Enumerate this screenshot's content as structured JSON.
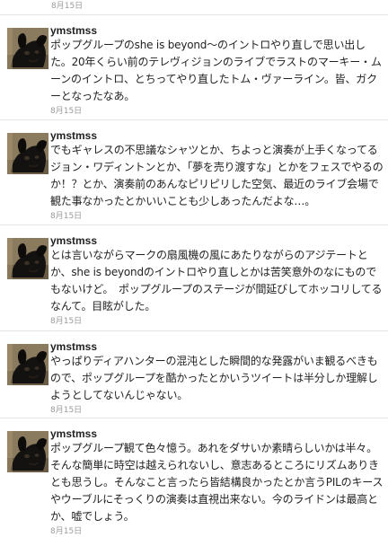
{
  "top_date": "8月15日",
  "tweets": [
    {
      "username": "ymstmss",
      "text": "ポップグループのshe is beyond〜のイントロやり直しで思い出した。20年くらい前のテレヴィジョンのライブでラストのマーキー・ムーンのイントロ、とちってやり直したトム・ヴァーライン。皆、ガクーとなったなあ。",
      "date": "8月15日"
    },
    {
      "username": "ymstmss",
      "text": "でもギャレスの不思議なシャツとか、ちよっと演奏が上手くなってるジョン・ワディントンとか、「夢を売り渡すな」とかをフェスでやるのか！？とか、演奏前のあんなピリピリした空気、最近のライブ会場で観た事なかったとかいいことも少しあったんだよな…。",
      "date": "8月15日"
    },
    {
      "username": "ymstmss",
      "text": "とは言いながらマークの扇風機の風にあたりながらのアジテートとか、she is beyondのイントロやり直しとかは苦笑意外のなにものでもないけど。　ポップグループのステージが間延びしてホッコリしてるなんて。目眩がした。",
      "date": "8月15日"
    },
    {
      "username": "ymstmss",
      "text": "やっぱりディアハンターの混沌とした瞬間的な発露がいま観るべきもので、ポップグループを酷かったとかいうツイートは半分しか理解しようとしてないんじゃない。",
      "date": "8月15日"
    },
    {
      "username": "ymstmss",
      "text": "ポップグループ観て色々憶う。あれをダサいか素晴らしいかは半々。そんな簡単に時空は越えられないし、意志あるところにリズムありきとも思うし。そんなこと言ったら皆結構良かったとか言うPILのキースやウーブルにそっくりの演奏は直視出来ない。今のライドンは最高とか、嘘でしょう。",
      "date": "8月15日"
    }
  ],
  "avatar_icon": "black-dog-photo-icon"
}
